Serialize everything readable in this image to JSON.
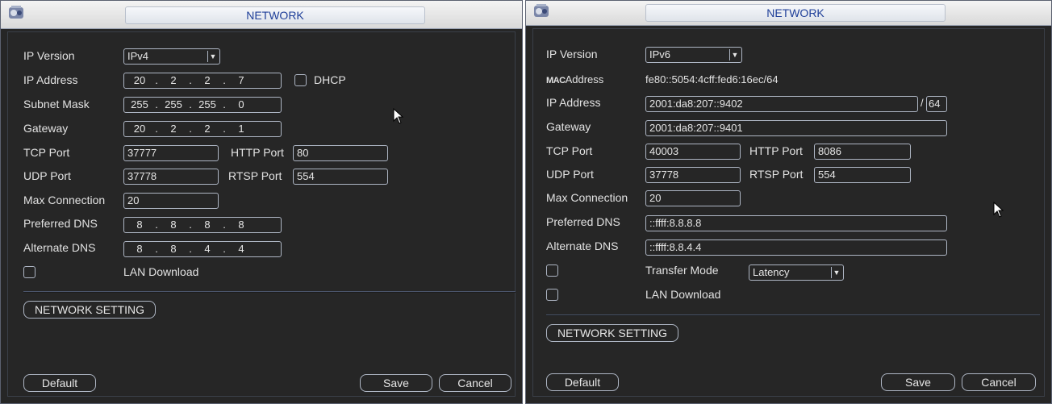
{
  "left": {
    "title": "NETWORK",
    "labels": {
      "ip_version": "IP Version",
      "ip_address": "IP Address",
      "subnet_mask": "Subnet Mask",
      "gateway": "Gateway",
      "tcp_port": "TCP Port",
      "http_port": "HTTP Port",
      "udp_port": "UDP Port",
      "rtsp_port": "RTSP Port",
      "max_connection": "Max Connection",
      "preferred_dns": "Preferred DNS",
      "alternate_dns": "Alternate DNS",
      "dhcp": "DHCP",
      "lan_download": "LAN Download"
    },
    "values": {
      "ip_version": "IPv4",
      "ip_address": [
        "20",
        "2",
        "2",
        "7"
      ],
      "subnet_mask": [
        "255",
        "255",
        "255",
        "0"
      ],
      "gateway": [
        "20",
        "2",
        "2",
        "1"
      ],
      "tcp_port": "37777",
      "http_port": "80",
      "udp_port": "37778",
      "rtsp_port": "554",
      "max_connection": "20",
      "preferred_dns": [
        "8",
        "8",
        "8",
        "8"
      ],
      "alternate_dns": [
        "8",
        "8",
        "4",
        "4"
      ]
    },
    "buttons": {
      "network_setting": "NETWORK SETTING",
      "default": "Default",
      "save": "Save",
      "cancel": "Cancel"
    }
  },
  "right": {
    "title": "NETWORK",
    "labels": {
      "ip_version": "IP Version",
      "mac_prefix": "MAC",
      "mac_suffix": "Address",
      "ip_address": "IP Address",
      "gateway": "Gateway",
      "tcp_port": "TCP Port",
      "http_port": "HTTP Port",
      "udp_port": "UDP Port",
      "rtsp_port": "RTSP Port",
      "max_connection": "Max Connection",
      "preferred_dns": "Preferred DNS",
      "alternate_dns": "Alternate DNS",
      "transfer_mode": "Transfer Mode",
      "lan_download": "LAN Download",
      "prefix_slash": "/"
    },
    "values": {
      "ip_version": "IPv6",
      "mac_address": "fe80::5054:4cff:fed6:16ec/64",
      "ip_address": "2001:da8:207::9402",
      "prefix_length": "64",
      "gateway": "2001:da8:207::9401",
      "tcp_port": "40003",
      "http_port": "8086",
      "udp_port": "37778",
      "rtsp_port": "554",
      "max_connection": "20",
      "preferred_dns": "::ffff:8.8.8.8",
      "alternate_dns": "::ffff:8.8.4.4",
      "transfer_mode": "Latency"
    },
    "buttons": {
      "network_setting": "NETWORK SETTING",
      "default": "Default",
      "save": "Save",
      "cancel": "Cancel"
    }
  },
  "icons": {
    "app": "app-logo-icon",
    "dropdown": "chevron-down-icon",
    "cursor": "mouse-pointer-icon"
  },
  "colors": {
    "panel_bg": "#262626",
    "title_text": "#1f3f99",
    "field_border": "#aeb6c4",
    "label_text": "#e2e2e2"
  }
}
